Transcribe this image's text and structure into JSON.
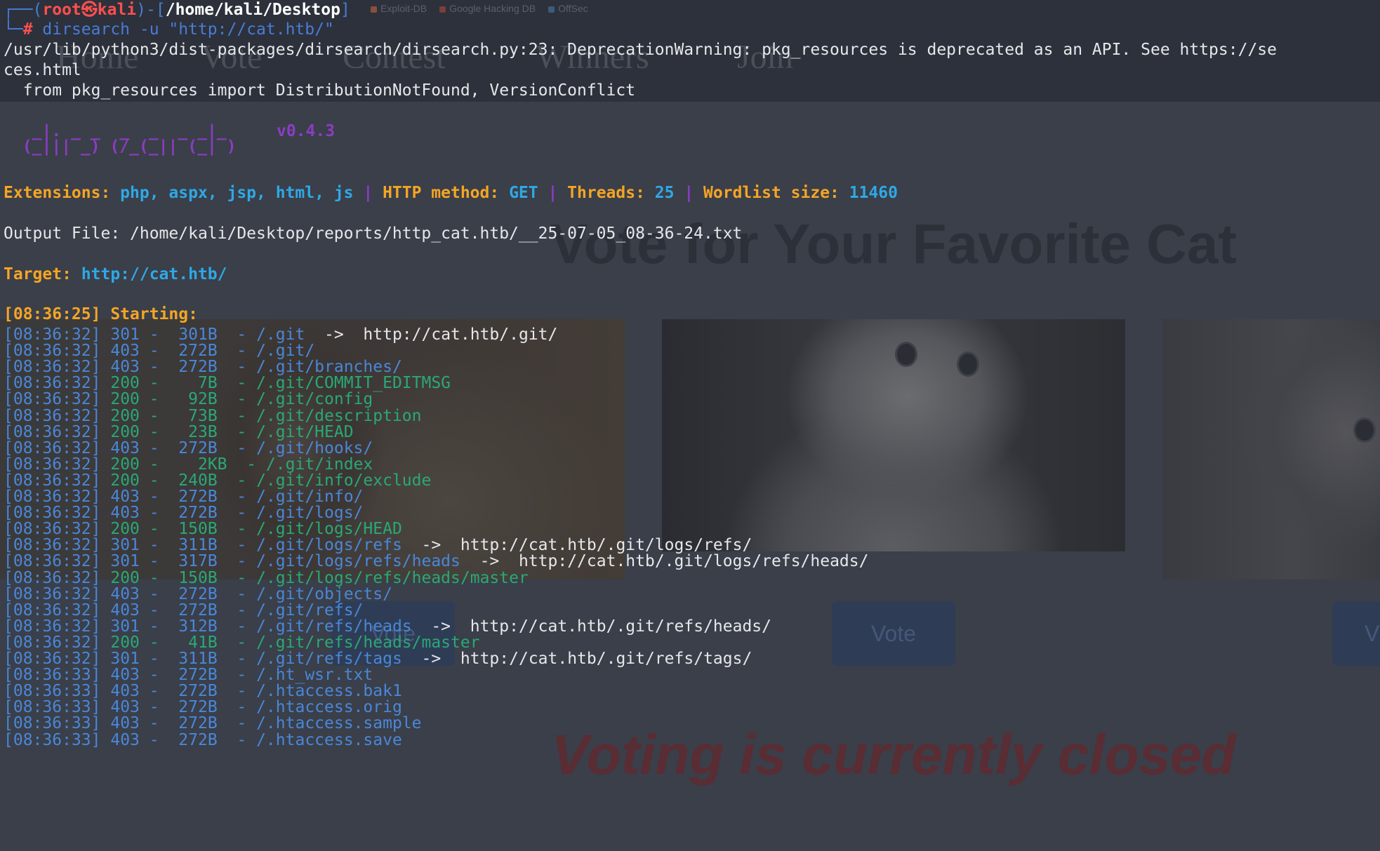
{
  "background_page": {
    "bookmarks": [
      "Exploit-DB",
      "Google Hacking DB",
      "OffSec"
    ],
    "nav": [
      "Home",
      "Vote",
      "Contest",
      "Winners",
      "Join"
    ],
    "hero_title": "Vote for Your Favorite Cat",
    "vote_label": "Vote",
    "closed_message": "Voting is currently closed"
  },
  "terminal": {
    "prompt": {
      "corner_top": "┌──(",
      "user": "root㉿kali",
      "mid": ")-[",
      "cwd": "/home/kali/Desktop",
      "end": "]",
      "corner_bottom": "└─",
      "symbol": "#",
      "command": " dirsearch -u \"http://cat.htb/\""
    },
    "warning_lines": [
      "/usr/lib/python3/dist-packages/dirsearch/dirsearch.py:23: DeprecationWarning: pkg_resources is deprecated as an API. See https://se",
      "ces.html",
      "  from pkg_resources import DistributionNotFound, VersionConflict"
    ],
    "logo_lines": [
      "  _|. _ _  _  _  _ _|_",
      " (_||| _) (/_(_|| (_| )"
    ],
    "version": "v0.4.3",
    "config": {
      "extensions_label": "Extensions: ",
      "extensions": "php, aspx, jsp, html, js",
      "sep": " | ",
      "method_label": "HTTP method: ",
      "method": "GET",
      "threads_label": "Threads: ",
      "threads": "25",
      "wordlist_label": "Wordlist size: ",
      "wordlist_size": "11460"
    },
    "output_file_label": "Output File: ",
    "output_file": "/home/kali/Desktop/reports/http_cat.htb/__25-07-05_08-36-24.txt",
    "target_label": "Target: ",
    "target": "http://cat.htb/",
    "starting_time": "[08:36:25]",
    "starting_label": " Starting:",
    "results": [
      {
        "time": "[08:36:32]",
        "status": "301",
        "size": " 301B",
        "path": "/.git",
        "redirect": "http://cat.htb/.git/"
      },
      {
        "time": "[08:36:32]",
        "status": "403",
        "size": " 272B",
        "path": "/.git/",
        "redirect": ""
      },
      {
        "time": "[08:36:32]",
        "status": "403",
        "size": " 272B",
        "path": "/.git/branches/",
        "redirect": ""
      },
      {
        "time": "[08:36:32]",
        "status": "200",
        "size": "   7B",
        "path": "/.git/COMMIT_EDITMSG",
        "redirect": ""
      },
      {
        "time": "[08:36:32]",
        "status": "200",
        "size": "  92B",
        "path": "/.git/config",
        "redirect": ""
      },
      {
        "time": "[08:36:32]",
        "status": "200",
        "size": "  73B",
        "path": "/.git/description",
        "redirect": ""
      },
      {
        "time": "[08:36:32]",
        "status": "200",
        "size": "  23B",
        "path": "/.git/HEAD",
        "redirect": ""
      },
      {
        "time": "[08:36:32]",
        "status": "403",
        "size": " 272B",
        "path": "/.git/hooks/",
        "redirect": ""
      },
      {
        "time": "[08:36:32]",
        "status": "200",
        "size": "   2KB",
        "path": "/.git/index",
        "redirect": ""
      },
      {
        "time": "[08:36:32]",
        "status": "200",
        "size": " 240B",
        "path": "/.git/info/exclude",
        "redirect": ""
      },
      {
        "time": "[08:36:32]",
        "status": "403",
        "size": " 272B",
        "path": "/.git/info/",
        "redirect": ""
      },
      {
        "time": "[08:36:32]",
        "status": "403",
        "size": " 272B",
        "path": "/.git/logs/",
        "redirect": ""
      },
      {
        "time": "[08:36:32]",
        "status": "200",
        "size": " 150B",
        "path": "/.git/logs/HEAD",
        "redirect": ""
      },
      {
        "time": "[08:36:32]",
        "status": "301",
        "size": " 311B",
        "path": "/.git/logs/refs",
        "redirect": "http://cat.htb/.git/logs/refs/"
      },
      {
        "time": "[08:36:32]",
        "status": "301",
        "size": " 317B",
        "path": "/.git/logs/refs/heads",
        "redirect": "http://cat.htb/.git/logs/refs/heads/"
      },
      {
        "time": "[08:36:32]",
        "status": "200",
        "size": " 150B",
        "path": "/.git/logs/refs/heads/master",
        "redirect": ""
      },
      {
        "time": "[08:36:32]",
        "status": "403",
        "size": " 272B",
        "path": "/.git/objects/",
        "redirect": ""
      },
      {
        "time": "[08:36:32]",
        "status": "403",
        "size": " 272B",
        "path": "/.git/refs/",
        "redirect": ""
      },
      {
        "time": "[08:36:32]",
        "status": "301",
        "size": " 312B",
        "path": "/.git/refs/heads",
        "redirect": "http://cat.htb/.git/refs/heads/"
      },
      {
        "time": "[08:36:32]",
        "status": "200",
        "size": "  41B",
        "path": "/.git/refs/heads/master",
        "redirect": ""
      },
      {
        "time": "[08:36:32]",
        "status": "301",
        "size": " 311B",
        "path": "/.git/refs/tags",
        "redirect": "http://cat.htb/.git/refs/tags/"
      },
      {
        "time": "[08:36:33]",
        "status": "403",
        "size": " 272B",
        "path": "/.ht_wsr.txt",
        "redirect": ""
      },
      {
        "time": "[08:36:33]",
        "status": "403",
        "size": " 272B",
        "path": "/.htaccess.bak1",
        "redirect": ""
      },
      {
        "time": "[08:36:33]",
        "status": "403",
        "size": " 272B",
        "path": "/.htaccess.orig",
        "redirect": ""
      },
      {
        "time": "[08:36:33]",
        "status": "403",
        "size": " 272B",
        "path": "/.htaccess.sample",
        "redirect": ""
      },
      {
        "time": "[08:36:33]",
        "status": "403",
        "size": " 272B",
        "path": "/.htaccess.save",
        "redirect": ""
      }
    ]
  },
  "colors": {
    "status_200": "#2aa876",
    "status_301": "#4a87d9",
    "status_403": "#4a87d9",
    "orange": "#f5a524",
    "cyan": "#2fa8e6",
    "purple": "#8c3cc4",
    "prompt_red": "#ff4f4f"
  }
}
